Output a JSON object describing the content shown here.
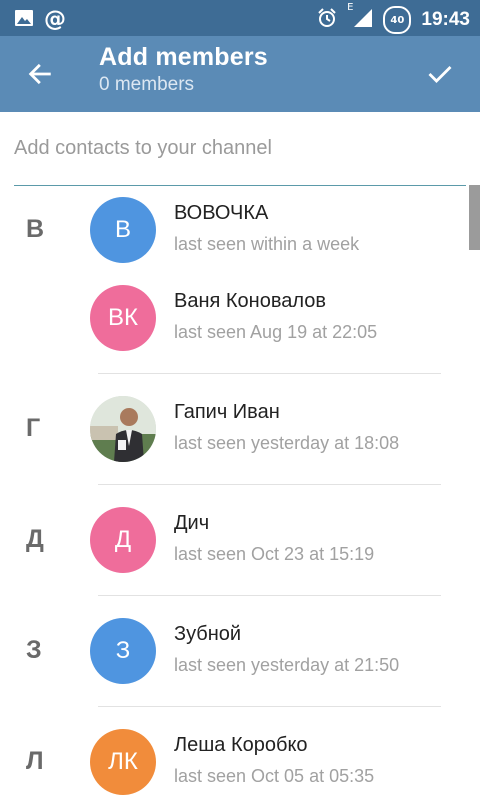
{
  "statusbar": {
    "time": "19:43",
    "network": "E",
    "battery": "40"
  },
  "header": {
    "title": "Add members",
    "subtitle": "0 members"
  },
  "search": {
    "placeholder": "Add contacts to your channel"
  },
  "contacts": [
    {
      "letter": "В",
      "initials": "В",
      "name": "ВОВОЧКА",
      "status": "last seen within a week",
      "color": "#4f95e0"
    },
    {
      "letter": "",
      "initials": "ВК",
      "name": "Ваня Коновалов",
      "status": "last seen Aug 19 at 22:05",
      "color": "#ef6d9b"
    },
    {
      "letter": "Г",
      "initials": "",
      "name": "Гапич Иван",
      "status": "last seen yesterday at 18:08",
      "photo": true
    },
    {
      "letter": "Д",
      "initials": "Д",
      "name": "Дич",
      "status": "last seen Oct 23 at 15:19",
      "color": "#ef6d9b"
    },
    {
      "letter": "З",
      "initials": "З",
      "name": "Зубной",
      "status": "last seen yesterday at 21:50",
      "color": "#4f95e0"
    },
    {
      "letter": "Л",
      "initials": "ЛК",
      "name": "Леша Коробко",
      "status": "last seen Oct 05 at 05:35",
      "color": "#f18c3b"
    }
  ]
}
